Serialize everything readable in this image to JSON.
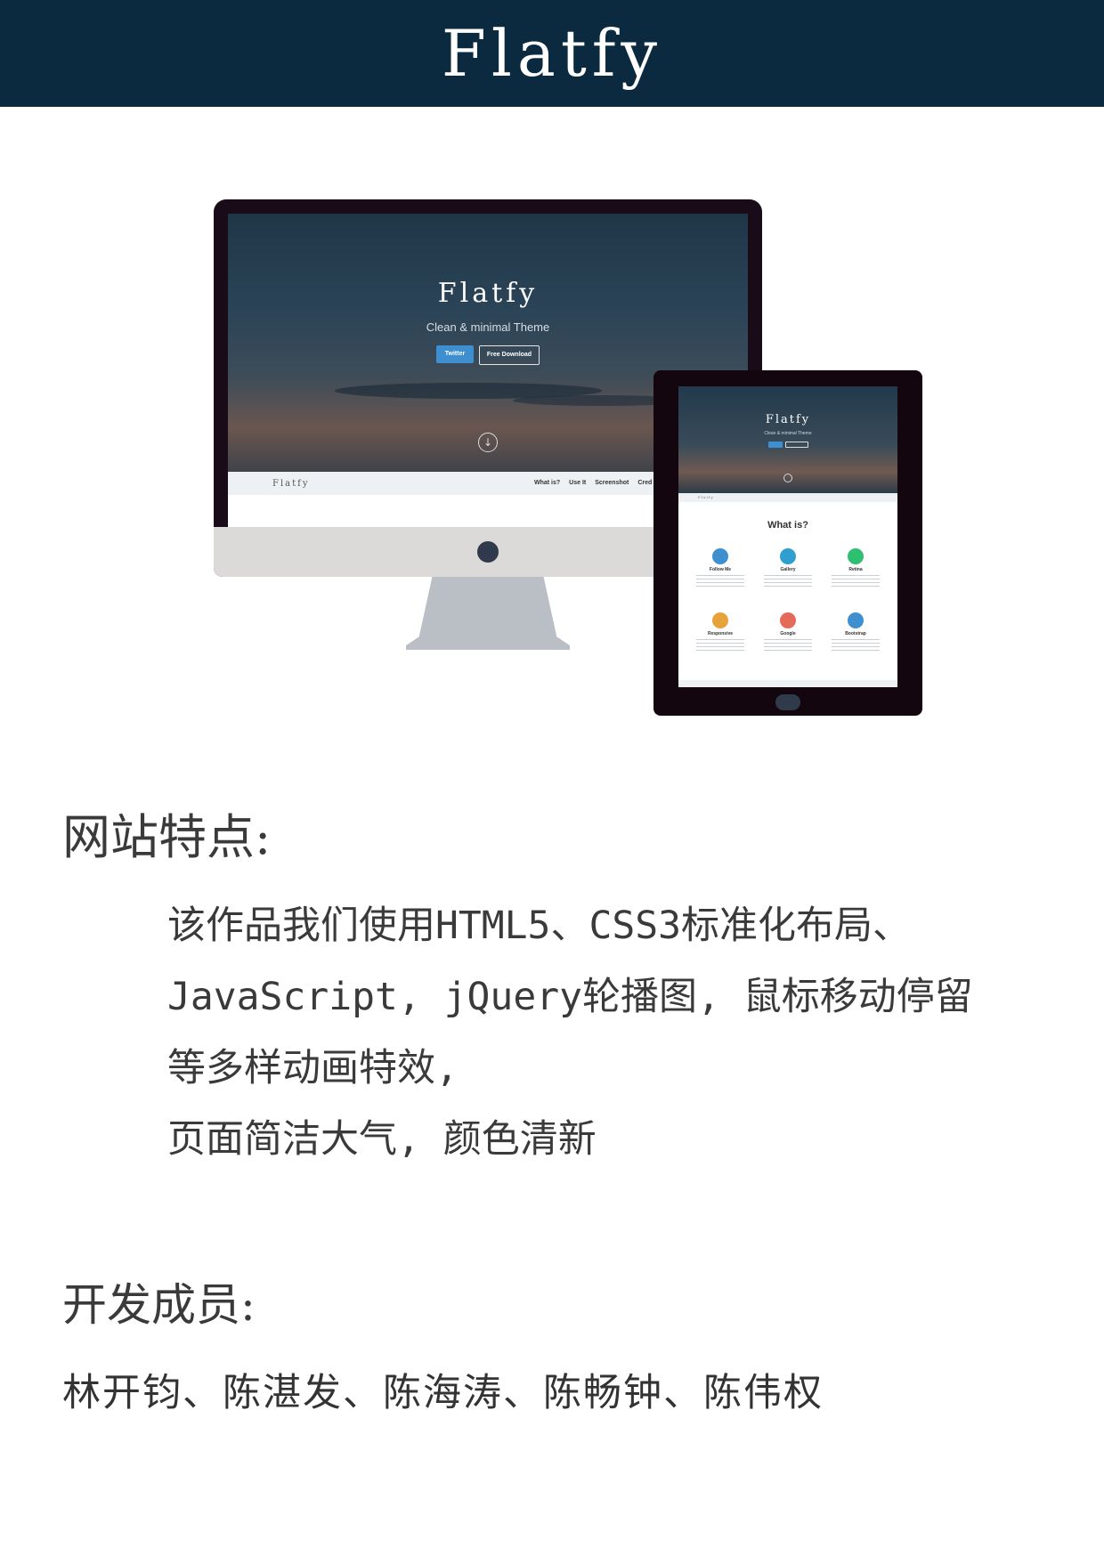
{
  "header": {
    "title": "Flatfy"
  },
  "monitor_preview": {
    "title": "Flatfy",
    "subtitle": "Clean & minimal Theme",
    "primary_button": "Twitter",
    "secondary_button": "Free Download",
    "nav_brand": "Flatfy",
    "nav_links": [
      "What is?",
      "Use It",
      "Screenshot",
      "Cred"
    ]
  },
  "tablet_preview": {
    "title": "Flatfy",
    "subtitle": "Clean & minimal Theme",
    "section_title": "What is?",
    "features": [
      {
        "label": "Follow Me",
        "color": "#3e8fcf"
      },
      {
        "label": "Gallery",
        "color": "#2f9fd0"
      },
      {
        "label": "Retina",
        "color": "#2fbf71"
      },
      {
        "label": "Responsive",
        "color": "#e8a23a"
      },
      {
        "label": "Google",
        "color": "#e46b5a"
      },
      {
        "label": "Bootstrap",
        "color": "#3e8fcf"
      }
    ]
  },
  "features_section": {
    "heading": "网站特点:",
    "lines": [
      "该作品我们使用HTML5、CSS3标准化布局、",
      "JavaScript, jQuery轮播图, 鼠标移动停留",
      "等多样动画特效,",
      "页面简洁大气, 颜色清新"
    ]
  },
  "team_section": {
    "heading": "开发成员:",
    "members": "林开钧、陈湛发、陈海涛、陈畅钟、陈伟权"
  },
  "colors": {
    "header_bg": "#0b2a40",
    "accent": "#3e8fcf",
    "text": "#3a3a3a"
  }
}
